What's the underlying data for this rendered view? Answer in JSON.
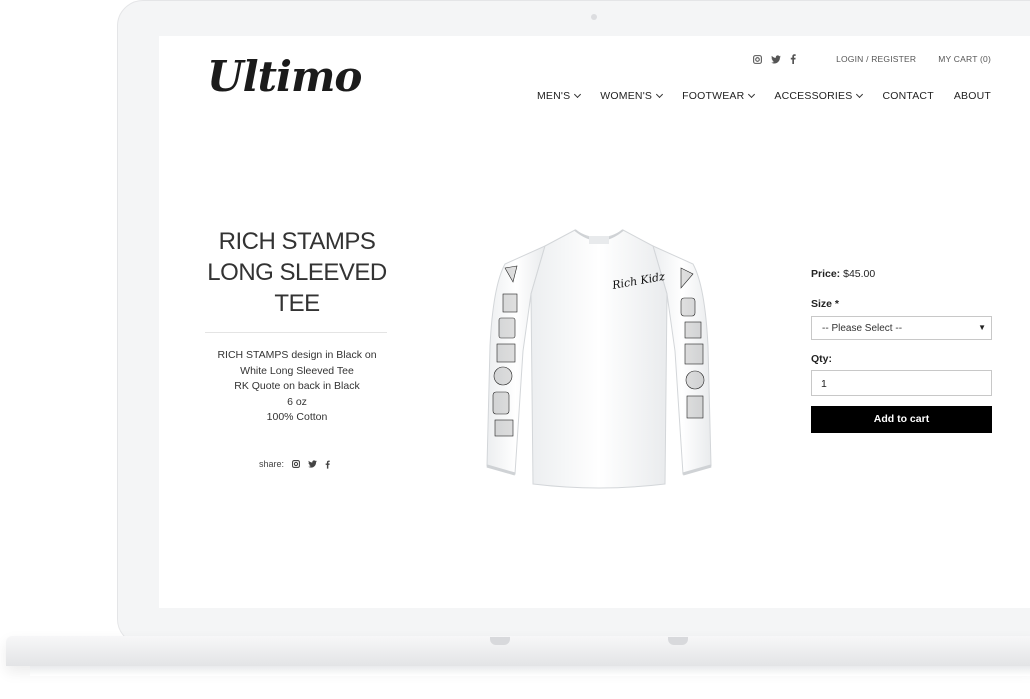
{
  "site": {
    "logo": "Ultimo"
  },
  "topbar": {
    "social": [
      "instagram-icon",
      "twitter-icon",
      "facebook-icon"
    ],
    "login_label": "LOGIN / REGISTER",
    "cart_label": "MY CART (0)"
  },
  "nav": {
    "items": [
      {
        "label": "MEN'S",
        "dropdown": true
      },
      {
        "label": "WOMEN'S",
        "dropdown": true
      },
      {
        "label": "FOOTWEAR",
        "dropdown": true
      },
      {
        "label": "ACCESSORIES",
        "dropdown": true
      },
      {
        "label": "CONTACT",
        "dropdown": false
      },
      {
        "label": "ABOUT",
        "dropdown": false
      }
    ]
  },
  "product": {
    "title_lines": [
      "RICH STAMPS",
      "LONG SLEEVED",
      "TEE"
    ],
    "description": [
      "RICH STAMPS design in Black on",
      "White Long Sleeved Tee",
      "RK Quote on back in Black",
      "6 oz",
      "100% Cotton"
    ],
    "share_label": "share:",
    "price_label": "Price:",
    "price": "$45.00",
    "size_label": "Size *",
    "size_selected": "-- Please Select --",
    "qty_label": "Qty:",
    "qty_value": "1",
    "add_to_cart_label": "Add to cart",
    "shirt_script": "Rich Kidz"
  },
  "colors": {
    "button_bg": "#000000",
    "button_text": "#ffffff",
    "frame": "#f4f5f6"
  }
}
